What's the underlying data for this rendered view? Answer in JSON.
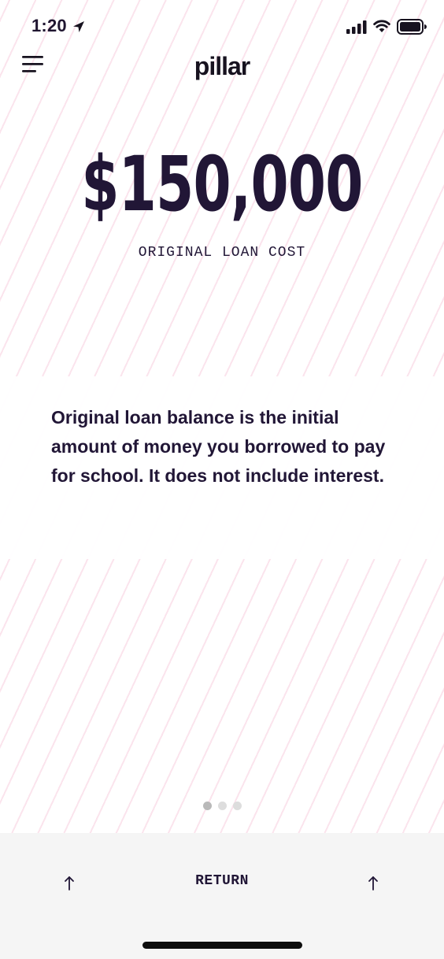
{
  "status_bar": {
    "time": "1:20"
  },
  "header": {
    "logo_text": "pillar"
  },
  "main": {
    "amount": "$150,000",
    "amount_label": "ORIGINAL LOAN COST",
    "description": "Original loan balance is the initial amount of money you borrowed to pay for school. It does not include interest.",
    "pager": {
      "total": 3,
      "active_index": 0
    }
  },
  "bottom_bar": {
    "return_label": "RETURN"
  },
  "colors": {
    "text": "#211636",
    "pattern_accent": "#f8cede",
    "bottom_bar_bg": "#f5f5f5",
    "pager_active": "#b9b9b9",
    "pager_inactive": "#dddddd"
  },
  "icons": {
    "menu": "hamburger-menu-icon",
    "location": "location-arrow-icon",
    "signal": "cellular-signal-icon",
    "wifi": "wifi-icon",
    "battery": "battery-icon",
    "arrow_left": "arrow-up-icon",
    "arrow_right": "arrow-up-icon"
  }
}
